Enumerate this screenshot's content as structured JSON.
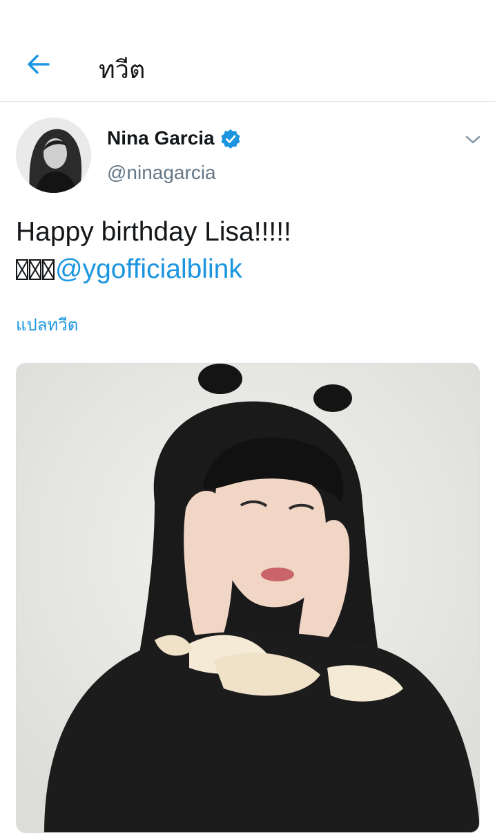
{
  "header": {
    "title": "ทวีต",
    "back_icon": "arrow-left-icon"
  },
  "tweet": {
    "display_name": "Nina Garcia",
    "verified_icon": "verified-badge-icon",
    "handle": "@ninagarcia",
    "menu_icon": "chevron-down-icon",
    "text_line1": "Happy birthday Lisa!!!!!",
    "emoji_count": 3,
    "mention": "@ygofficialblink",
    "translate_label": "แปลทวีต",
    "media_alt": "photo"
  },
  "colors": {
    "accent": "#1b95e0",
    "secondary_text": "#657786",
    "divider": "#d9dde1"
  }
}
